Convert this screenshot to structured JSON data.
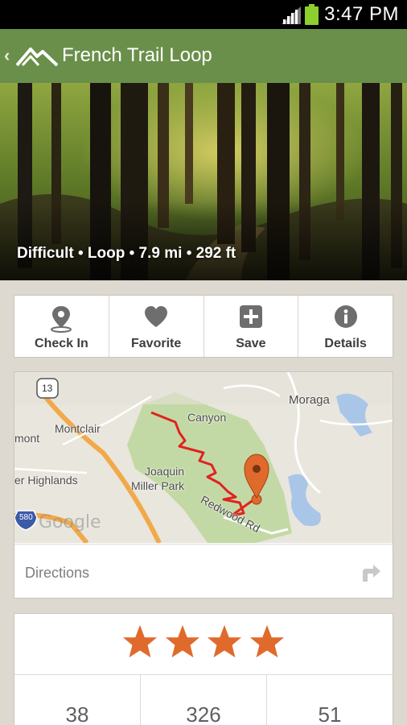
{
  "status_bar": {
    "time": "3:47 PM"
  },
  "header": {
    "title": "French Trail Loop",
    "back_icon": "chevron-left-icon",
    "logo_icon": "mountain-logo-icon"
  },
  "hero": {
    "stats": "Difficult • Loop • 7.9 mi • 292 ft"
  },
  "actions": [
    {
      "label": "Check In",
      "icon": "map-pin-icon"
    },
    {
      "label": "Favorite",
      "icon": "heart-icon"
    },
    {
      "label": "Save",
      "icon": "plus-square-icon"
    },
    {
      "label": "Details",
      "icon": "info-circle-icon"
    }
  ],
  "map": {
    "labels": {
      "moraga": "Moraga",
      "canyon": "Canyon",
      "montclair": "Montclair",
      "mont": "mont",
      "joaquin": "Joaquin",
      "miller_park": "Miller Park",
      "highlands": "er Highlands",
      "redwood_rd": "Redwood Rd",
      "route_13": "13",
      "route_580": "580",
      "watermark": "Google"
    },
    "route_color": "#e0231f",
    "marker_color": "#e06a2c"
  },
  "directions": {
    "label": "Directions",
    "icon": "turn-right-arrow-icon"
  },
  "rating": {
    "stars": 4,
    "star_color": "#e06a2c"
  },
  "counts": [
    "38",
    "326",
    "51"
  ]
}
